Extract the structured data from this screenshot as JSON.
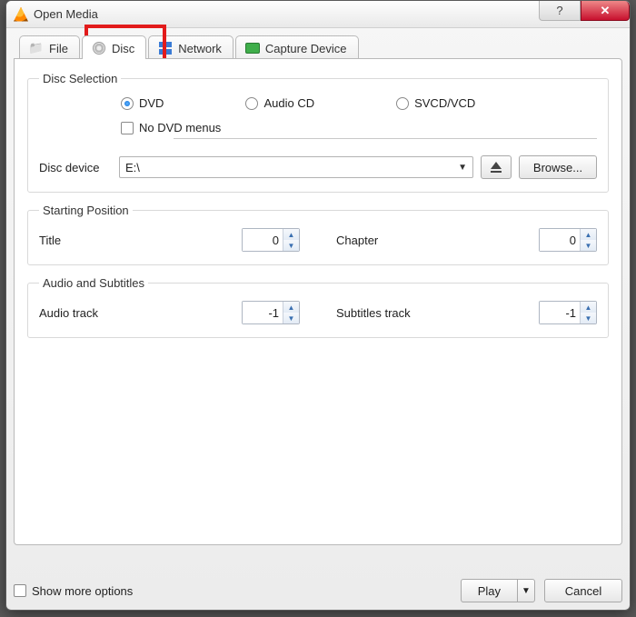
{
  "window": {
    "title": "Open Media"
  },
  "tabs": {
    "file": {
      "label": "File"
    },
    "disc": {
      "label": "Disc"
    },
    "network": {
      "label": "Network"
    },
    "capture": {
      "label": "Capture Device"
    }
  },
  "disc_selection": {
    "legend": "Disc Selection",
    "dvd": "DVD",
    "audio_cd": "Audio CD",
    "svcd": "SVCD/VCD",
    "no_menus": "No DVD menus",
    "disc_device_label": "Disc device",
    "disc_device_value": "E:\\",
    "browse": "Browse..."
  },
  "starting_position": {
    "legend": "Starting Position",
    "title_label": "Title",
    "title_value": "0",
    "chapter_label": "Chapter",
    "chapter_value": "0"
  },
  "audio_subs": {
    "legend": "Audio and Subtitles",
    "audio_label": "Audio track",
    "audio_value": "-1",
    "subs_label": "Subtitles track",
    "subs_value": "-1"
  },
  "footer": {
    "show_more": "Show more options",
    "play": "Play",
    "cancel": "Cancel"
  },
  "titlebar_buttons": {
    "help": "?",
    "close": "✕"
  }
}
